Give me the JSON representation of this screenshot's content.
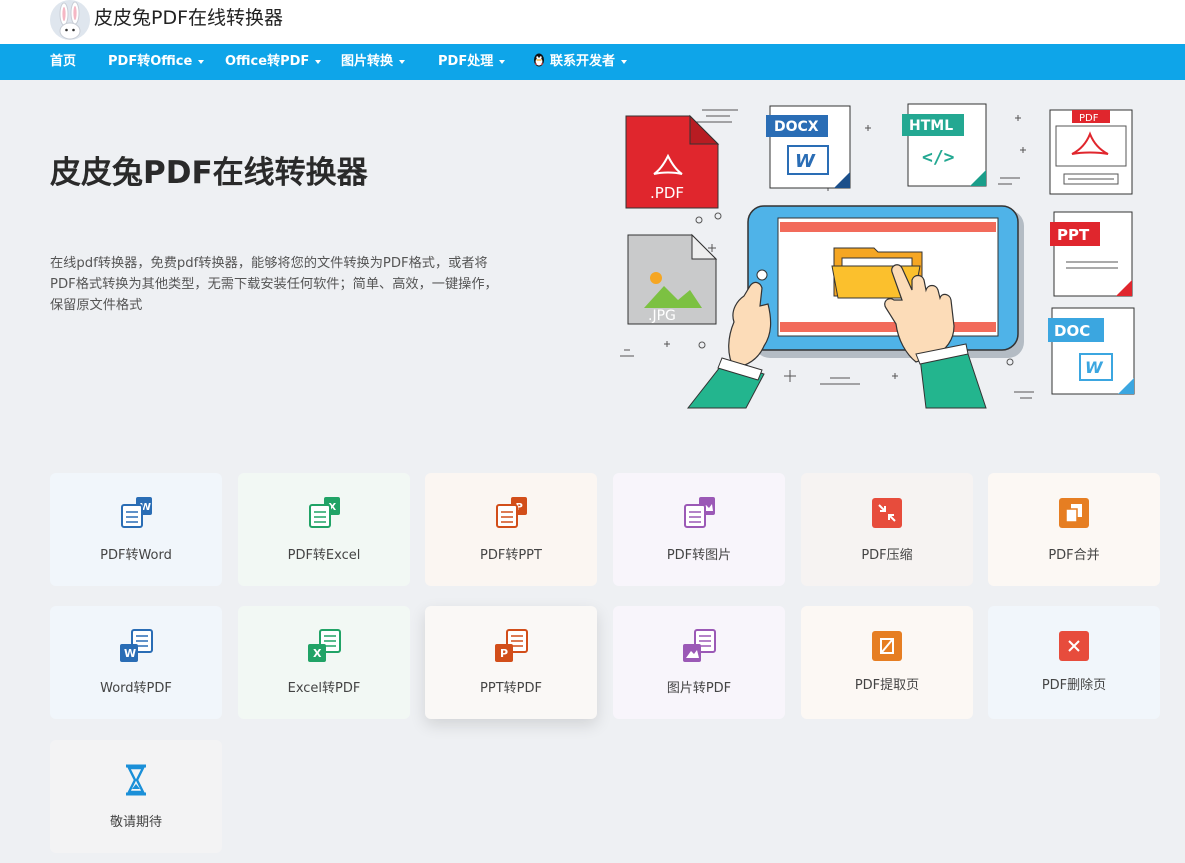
{
  "header": {
    "brand": "皮皮兔PDF在线转换器"
  },
  "nav": {
    "items": [
      {
        "label": "首页",
        "dropdown": false
      },
      {
        "label": "PDF转Office",
        "dropdown": true
      },
      {
        "label": "Office转PDF",
        "dropdown": true
      },
      {
        "label": "图片转换",
        "dropdown": true
      },
      {
        "label": "PDF处理",
        "dropdown": true
      },
      {
        "label": "联系开发者",
        "dropdown": true,
        "icon": "qq-penguin-icon"
      }
    ]
  },
  "hero": {
    "title": "皮皮兔PDF在线转换器",
    "description": "在线pdf转换器，免费pdf转换器，能够将您的文件转换为PDF格式，或者将PDF格式转换为其他类型，无需下载安装任何软件；简单、高效，一键操作，保留原文件格式",
    "illustration": {
      "pdf_label": ".PDF",
      "jpg_label": ".JPG",
      "docx_label": "DOCX",
      "html_label": "HTML",
      "html_symbol": "</>",
      "pdf_tag": "PDF",
      "ppt_tag": "PPT",
      "doc_tag": "DOC",
      "word_letter": "W"
    }
  },
  "tools": [
    {
      "label": "PDF转Word",
      "icon": "pdf-to-word-icon",
      "color": "#2a6db5",
      "letter": "W"
    },
    {
      "label": "PDF转Excel",
      "icon": "pdf-to-excel-icon",
      "color": "#21a366",
      "letter": "X"
    },
    {
      "label": "PDF转PPT",
      "icon": "pdf-to-ppt-icon",
      "color": "#d24e1a",
      "letter": "P"
    },
    {
      "label": "PDF转图片",
      "icon": "pdf-to-image-icon",
      "color": "#9b59b6",
      "letter": ""
    },
    {
      "label": "PDF压缩",
      "icon": "compress-icon",
      "color": "#e74c3c",
      "letter": ""
    },
    {
      "label": "PDF合并",
      "icon": "merge-icon",
      "color": "#e67e22",
      "letter": ""
    },
    {
      "label": "Word转PDF",
      "icon": "word-to-pdf-icon",
      "color": "#2a6db5",
      "letter": "W"
    },
    {
      "label": "Excel转PDF",
      "icon": "excel-to-pdf-icon",
      "color": "#21a366",
      "letter": "X"
    },
    {
      "label": "PPT转PDF",
      "icon": "ppt-to-pdf-icon",
      "color": "#d24e1a",
      "letter": "P"
    },
    {
      "label": "图片转PDF",
      "icon": "image-to-pdf-icon",
      "color": "#9b59b6",
      "letter": ""
    },
    {
      "label": "PDF提取页",
      "icon": "extract-page-icon",
      "color": "#e67e22",
      "letter": ""
    },
    {
      "label": "PDF删除页",
      "icon": "delete-page-icon",
      "color": "#e74c3c",
      "letter": ""
    },
    {
      "label": "敬请期待",
      "icon": "hourglass-icon",
      "color": "#1a8fd8",
      "letter": ""
    }
  ]
}
